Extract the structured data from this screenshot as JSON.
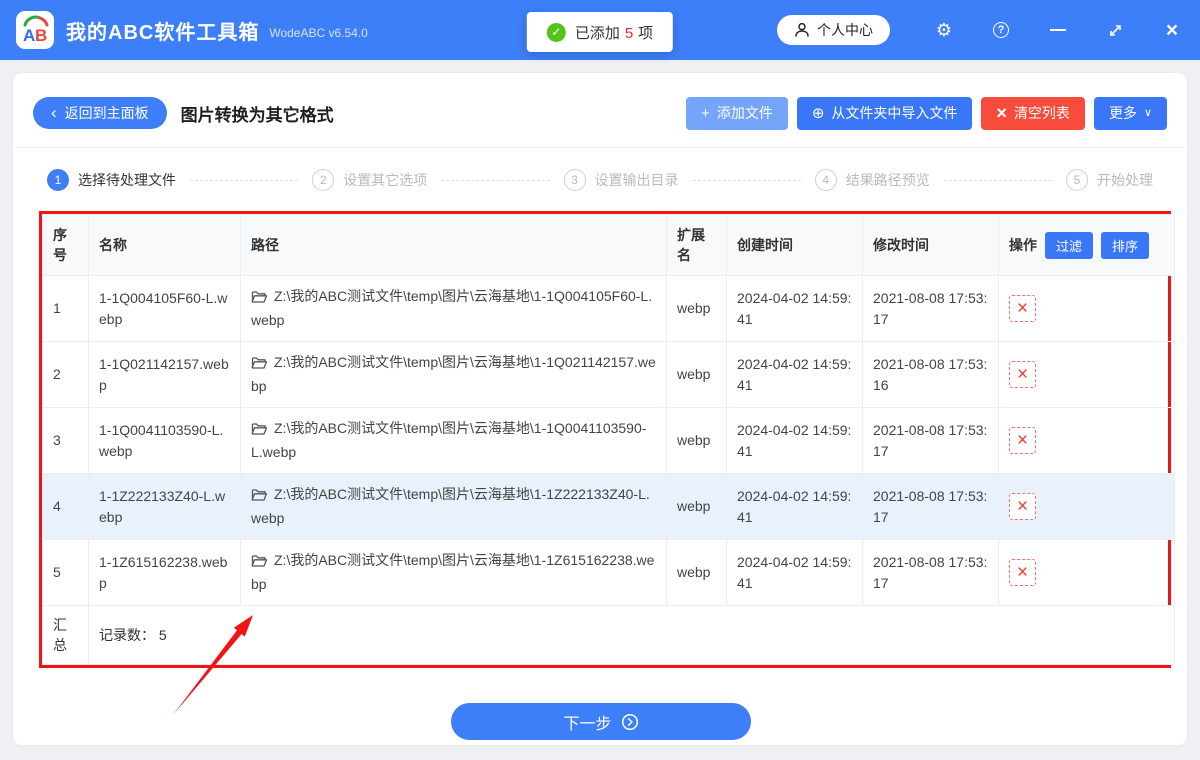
{
  "titlebar": {
    "logo_text_a": "A",
    "logo_text_b": "B",
    "app_name": "我的ABC软件工具箱",
    "version": "WodeABC v6.54.0",
    "added_badge": {
      "prefix": "已添加",
      "count": "5",
      "suffix": "项"
    },
    "profile_label": "个人中心"
  },
  "icons": {
    "check": "✓",
    "gear": "⚙",
    "question": "?",
    "close": "×",
    "back_chevron": "‹",
    "plus": "+",
    "circle_plus": "⊕",
    "clear_x": "×",
    "chevron_down": "∨",
    "remove": "×"
  },
  "toolbar": {
    "back_label": "返回到主面板",
    "page_title": "图片转换为其它格式",
    "add_files_label": "添加文件",
    "import_folder_label": "从文件夹中导入文件",
    "clear_list_label": "清空列表",
    "more_label": "更多"
  },
  "steps": [
    {
      "num": "1",
      "label": "选择待处理文件",
      "active": true
    },
    {
      "num": "2",
      "label": "设置其它选项",
      "active": false
    },
    {
      "num": "3",
      "label": "设置输出目录",
      "active": false
    },
    {
      "num": "4",
      "label": "结果路径预览",
      "active": false
    },
    {
      "num": "5",
      "label": "开始处理",
      "active": false
    }
  ],
  "table": {
    "headers": {
      "index": "序号",
      "name": "名称",
      "path": "路径",
      "ext": "扩展名",
      "created": "创建时间",
      "modified": "修改时间",
      "actions": "操作"
    },
    "filter_label": "过滤",
    "sort_label": "排序",
    "rows": [
      {
        "index": "1",
        "name": "1-1Q004105F60-L.webp",
        "path": "Z:\\我的ABC测试文件\\temp\\图片\\云海基地\\1-1Q004105F60-L.webp",
        "ext": "webp",
        "created": "2024-04-02 14:59:41",
        "modified": "2021-08-08 17:53:17",
        "highlighted": false
      },
      {
        "index": "2",
        "name": "1-1Q021142157.webp",
        "path": "Z:\\我的ABC测试文件\\temp\\图片\\云海基地\\1-1Q021142157.webp",
        "ext": "webp",
        "created": "2024-04-02 14:59:41",
        "modified": "2021-08-08 17:53:16",
        "highlighted": false
      },
      {
        "index": "3",
        "name": "1-1Q0041103590-L.webp",
        "path": "Z:\\我的ABC测试文件\\temp\\图片\\云海基地\\1-1Q0041103590-L.webp",
        "ext": "webp",
        "created": "2024-04-02 14:59:41",
        "modified": "2021-08-08 17:53:17",
        "highlighted": false
      },
      {
        "index": "4",
        "name": "1-1Z222133Z40-L.webp",
        "path": "Z:\\我的ABC测试文件\\temp\\图片\\云海基地\\1-1Z222133Z40-L.webp",
        "ext": "webp",
        "created": "2024-04-02 14:59:41",
        "modified": "2021-08-08 17:53:17",
        "highlighted": true
      },
      {
        "index": "5",
        "name": "1-1Z615162238.webp",
        "path": "Z:\\我的ABC测试文件\\temp\\图片\\云海基地\\1-1Z615162238.webp",
        "ext": "webp",
        "created": "2024-04-02 14:59:41",
        "modified": "2021-08-08 17:53:17",
        "highlighted": false
      }
    ],
    "summary_label": "汇总",
    "summary_text": "记录数： 5"
  },
  "footer": {
    "next_label": "下一步"
  },
  "colors": {
    "titlebar_blue": "#3d7ef9",
    "primary_blue": "#3a77f7",
    "light_blue_button": "#74a5fa",
    "danger_red": "#f74c3c",
    "annotation_red": "#f21414",
    "highlight_row": "#e9f1fd",
    "check_green": "#52c41a",
    "count_red": "#f5222d"
  }
}
